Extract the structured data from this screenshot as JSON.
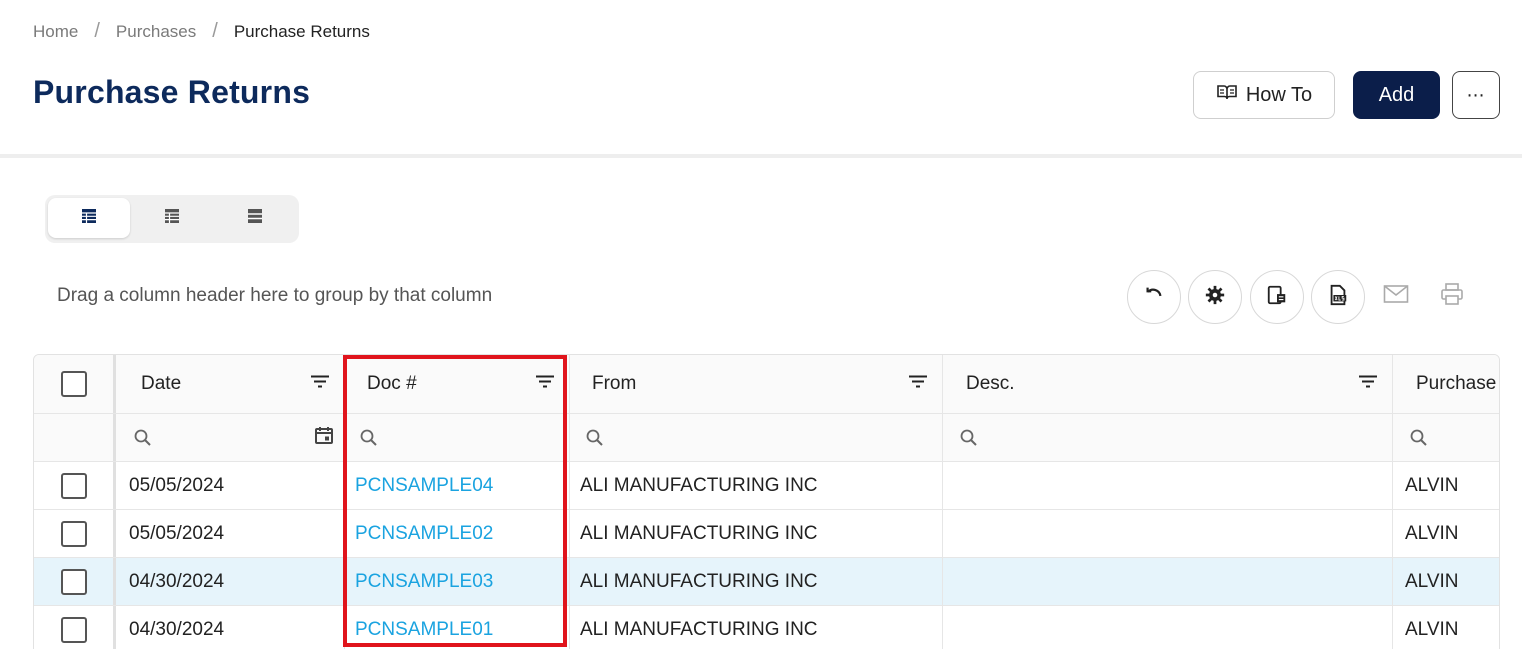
{
  "breadcrumb": {
    "home": "Home",
    "purchases": "Purchases",
    "current": "Purchase Returns",
    "separator": "/"
  },
  "page": {
    "title": "Purchase Returns"
  },
  "actions": {
    "howto_label": "How To",
    "add_label": "Add",
    "more_label": "⋯"
  },
  "view_switch": {
    "options": [
      "grid-view-icon",
      "table-view-icon",
      "compact-view-icon"
    ],
    "active": 0
  },
  "grid_toolbar": {
    "group_hint": "Drag a column header here to group by that column",
    "icons": [
      "undo-icon",
      "settings-icon",
      "export-icon",
      "export-xls-icon",
      "email-icon",
      "print-icon"
    ]
  },
  "grid": {
    "columns": [
      "Date",
      "Doc #",
      "From",
      "Desc.",
      "Purchase"
    ],
    "rows": [
      {
        "date": "05/05/2024",
        "doc": "PCNSAMPLE04",
        "from": "ALI MANUFACTURING INC",
        "desc": "",
        "purchaser": "ALVIN",
        "highlighted": false
      },
      {
        "date": "05/05/2024",
        "doc": "PCNSAMPLE02",
        "from": "ALI MANUFACTURING INC",
        "desc": "",
        "purchaser": "ALVIN",
        "highlighted": false
      },
      {
        "date": "04/30/2024",
        "doc": "PCNSAMPLE03",
        "from": "ALI MANUFACTURING INC",
        "desc": "",
        "purchaser": "ALVIN",
        "highlighted": true
      },
      {
        "date": "04/30/2024",
        "doc": "PCNSAMPLE01",
        "from": "ALI MANUFACTURING INC",
        "desc": "",
        "purchaser": "ALVIN",
        "highlighted": false
      }
    ]
  },
  "colors": {
    "title": "#0d2a5c",
    "add_button": "#0b1e4a",
    "link": "#1aa3e0",
    "highlight_row": "#e6f4fb",
    "annotation_box": "#e0141c"
  }
}
